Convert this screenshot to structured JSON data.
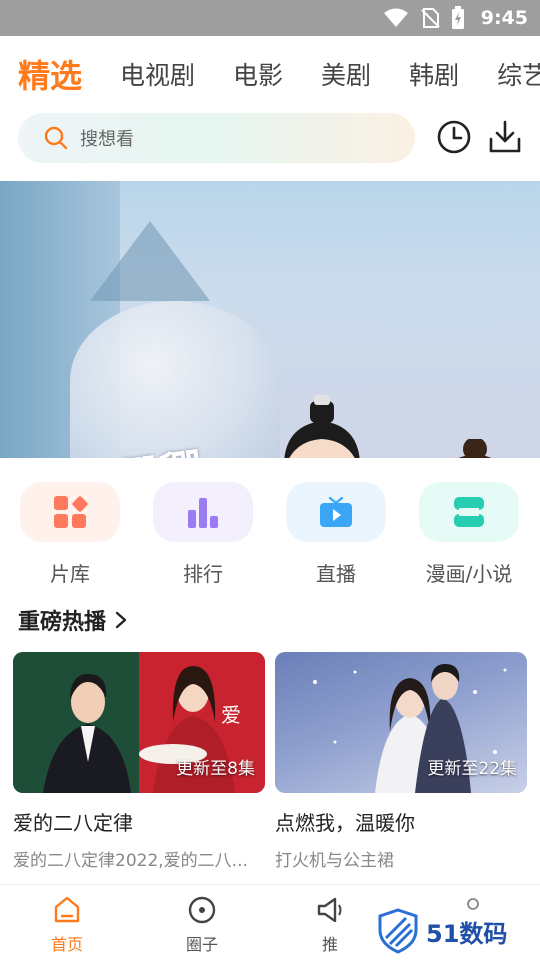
{
  "status_bar": {
    "time": "9:45"
  },
  "tabs": [
    {
      "label": "精选",
      "active": true
    },
    {
      "label": "电视剧",
      "active": false
    },
    {
      "label": "电影",
      "active": false
    },
    {
      "label": "美剧",
      "active": false
    },
    {
      "label": "韩剧",
      "active": false
    },
    {
      "label": "综艺",
      "active": false
    }
  ],
  "search": {
    "placeholder": "搜想看"
  },
  "banner": {
    "calligraphy": "卿卿日常"
  },
  "quick_links": [
    {
      "label": "片库",
      "icon": "grid-shapes-icon",
      "color": "#ff7a5c"
    },
    {
      "label": "排行",
      "icon": "bar-chart-icon",
      "color": "#9b7bf2"
    },
    {
      "label": "直播",
      "icon": "tv-play-icon",
      "color": "#3aa6f5"
    },
    {
      "label": "漫画/小说",
      "icon": "book-s-icon",
      "color": "#27cdb0"
    }
  ],
  "section": {
    "title": "重磅热播"
  },
  "cards": [
    {
      "badge": "更新至8集",
      "title": "爱的二八定律",
      "desc": "爱的二八定律2022,爱的二八..."
    },
    {
      "badge": "更新至22集",
      "title": "点燃我，温暖你",
      "desc": "打火机与公主裙"
    }
  ],
  "bottom_nav": [
    {
      "label": "首页",
      "icon": "home-icon",
      "active": true
    },
    {
      "label": "圈子",
      "icon": "circle-icon",
      "active": false
    },
    {
      "label": "推",
      "icon": "megaphone-icon",
      "active": false
    }
  ],
  "watermark": {
    "text": "51数码"
  },
  "colors": {
    "accent": "#ff7a1a"
  }
}
